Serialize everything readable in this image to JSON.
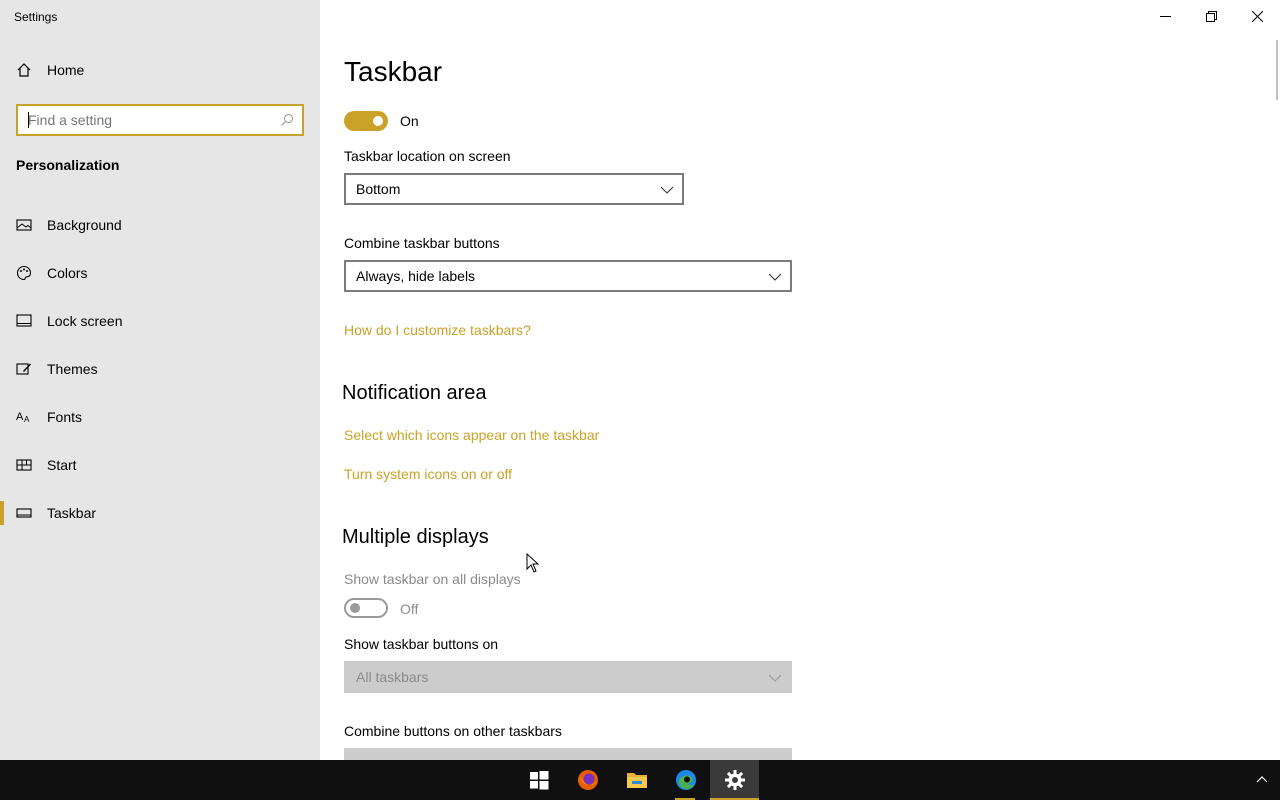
{
  "window": {
    "title": "Settings"
  },
  "sidebar": {
    "home_label": "Home",
    "search_placeholder": "Find a setting",
    "section_title": "Personalization",
    "items": [
      {
        "label": "Background",
        "icon": "image-icon"
      },
      {
        "label": "Colors",
        "icon": "palette-icon"
      },
      {
        "label": "Lock screen",
        "icon": "lock-screen-icon"
      },
      {
        "label": "Themes",
        "icon": "brush-icon"
      },
      {
        "label": "Fonts",
        "icon": "font-icon"
      },
      {
        "label": "Start",
        "icon": "start-tiles-icon"
      },
      {
        "label": "Taskbar",
        "icon": "taskbar-icon",
        "active": true
      }
    ]
  },
  "main": {
    "page_title": "Taskbar",
    "top_toggle": {
      "state": "On"
    },
    "location": {
      "label": "Taskbar location on screen",
      "value": "Bottom"
    },
    "combine": {
      "label": "Combine taskbar buttons",
      "value": "Always, hide labels"
    },
    "customize_link": "How do I customize taskbars?",
    "notification": {
      "heading": "Notification area",
      "link_icons": "Select which icons appear on the taskbar",
      "link_system": "Turn system icons on or off"
    },
    "multiple": {
      "heading": "Multiple displays",
      "show_all_label": "Show taskbar on all displays",
      "show_all_state": "Off",
      "buttons_on_label": "Show taskbar buttons on",
      "buttons_on_value": "All taskbars",
      "combine_other_label": "Combine buttons on other taskbars"
    }
  },
  "taskbar": {
    "apps": [
      "windows-start-icon",
      "firefox-icon",
      "file-explorer-icon",
      "edge-icon",
      "settings-gear-icon"
    ]
  },
  "colors": {
    "accent": "#c9a227",
    "sidebar_bg": "#e6e6e6",
    "taskbar_bg": "#101010"
  }
}
